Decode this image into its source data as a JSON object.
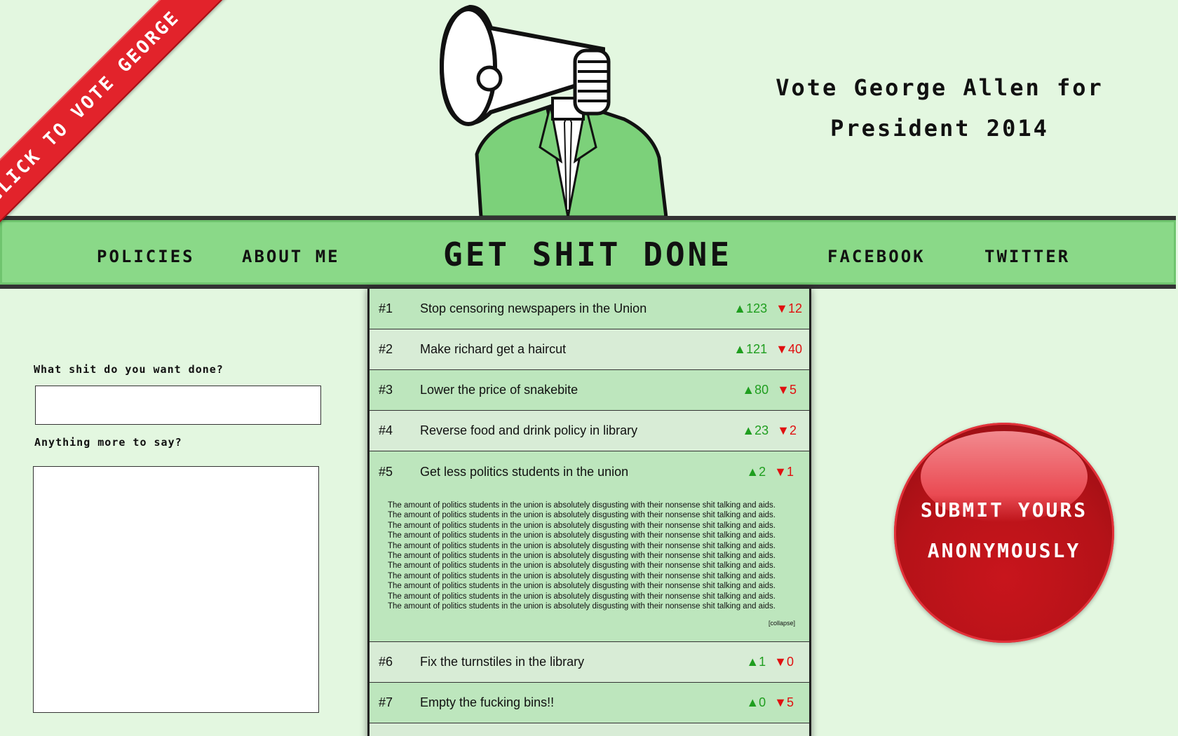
{
  "ribbon": {
    "label": "CLICK TO VOTE GEORGE"
  },
  "header": {
    "line1": "Vote George Allen for",
    "line2": "President 2014"
  },
  "nav": {
    "policies": "POLICIES",
    "about": "ABOUT ME",
    "title": "GET SHIT DONE",
    "facebook": "FACEBOOK",
    "twitter": "TWITTER"
  },
  "form": {
    "want_label": "What shit do you want done?",
    "more_label": "Anything more to say?",
    "want_value": "",
    "more_value": ""
  },
  "policies": [
    {
      "rank": "#1",
      "title": "Stop censoring newspapers in the Union",
      "up": "▲123",
      "down": "▼12"
    },
    {
      "rank": "#2",
      "title": "Make richard get a haircut",
      "up": "▲121",
      "down": "▼40"
    },
    {
      "rank": "#3",
      "title": "Lower the price of snakebite",
      "up": "▲80",
      "down": "▼5"
    },
    {
      "rank": "#4",
      "title": "Reverse food and drink policy in library",
      "up": "▲23",
      "down": "▼2"
    },
    {
      "rank": "#5",
      "title": "Get less politics students in the union",
      "up": "▲2",
      "down": "▼1",
      "body": "The amount of politics students in the union is absolutely disgusting with their nonsense shit talking and aids.",
      "collapse": "[collapse]"
    },
    {
      "rank": "#6",
      "title": "Fix the turnstiles in the library",
      "up": "▲1",
      "down": "▼0"
    },
    {
      "rank": "#7",
      "title": "Empty the fucking bins!!",
      "up": "▲0",
      "down": "▼5"
    }
  ],
  "submit": {
    "line1": "SUBMIT YOURS",
    "line2": "ANONYMOUSLY"
  },
  "colors": {
    "background": "#e3f7e0",
    "nav": "#8ad988",
    "ribbon": "#e2232b",
    "button": "#b51218",
    "up": "#1f9e1f",
    "down": "#e01010"
  }
}
